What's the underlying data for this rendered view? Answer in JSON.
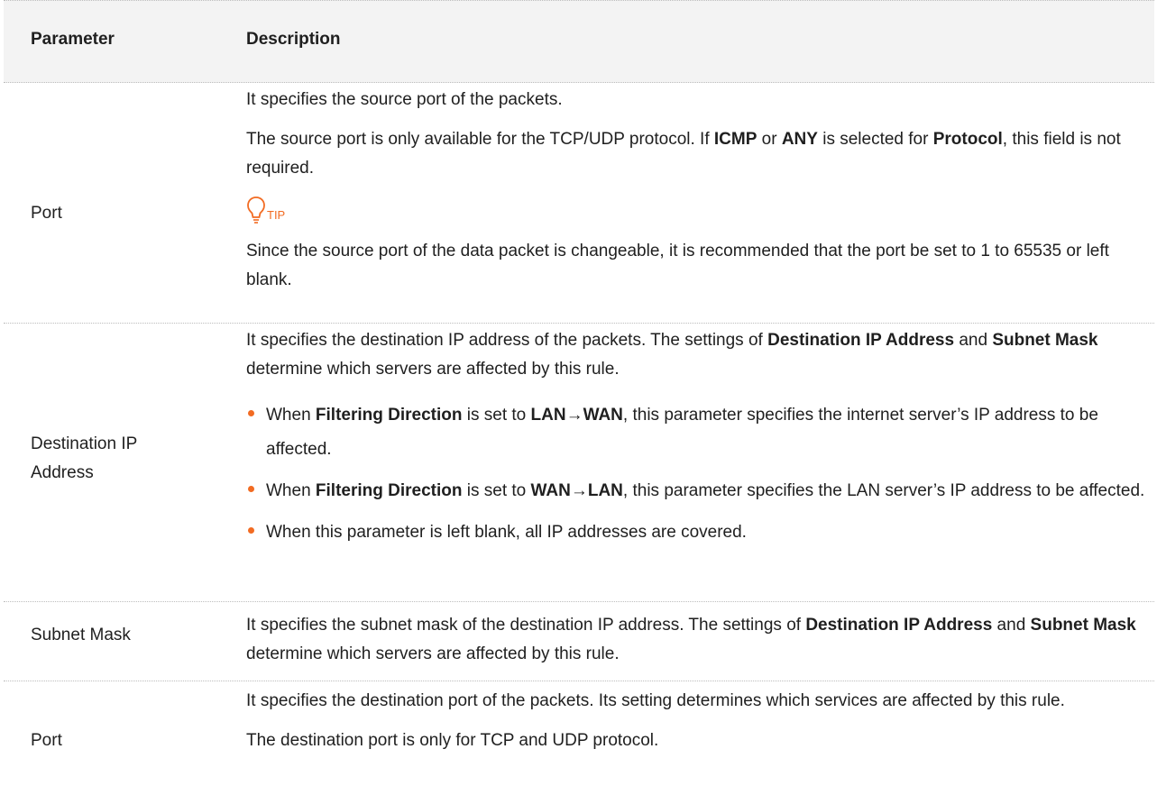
{
  "header": {
    "parameter": "Parameter",
    "description": "Description"
  },
  "rows": [
    {
      "parameter": "Port",
      "p1": "It specifies the source port of the packets.",
      "p2_a": "The source port is only available for the TCP/UDP protocol. If ",
      "p2_b": "ICMP",
      "p2_c": " or ",
      "p2_d": "ANY",
      "p2_e": " is selected for ",
      "p2_f": "Protocol",
      "p2_g": ", this field is not required.",
      "tip_label": "TIP",
      "tip_text": "Since the source port of the data packet is changeable, it is recommended that the port be set to 1 to 65535 or left blank."
    },
    {
      "parameter_line1": "Destination IP",
      "parameter_line2": "Address",
      "p1_a": "It specifies the destination IP address of the packets. The settings of ",
      "p1_b": "Destination IP Address",
      "p1_c": " and ",
      "p1_d": "Subnet Mask",
      "p1_e": " determine which servers are affected by this rule.",
      "b1_a": "When ",
      "b1_b": "Filtering Direction",
      "b1_c": " is set to ",
      "b1_d": "LAN→WAN",
      "b1_e": ", this parameter specifies the internet server’s IP address to be affected.",
      "b2_a": "When ",
      "b2_b": "Filtering Direction",
      "b2_c": " is set to ",
      "b2_d": "WAN→LAN",
      "b2_e": ", this parameter specifies the LAN server’s IP address to be affected.",
      "b3": "When this parameter is left blank, all IP addresses are covered."
    },
    {
      "parameter": "Subnet Mask",
      "p1_a": "It specifies the subnet mask of the destination IP address. The settings of ",
      "p1_b": "Destination IP Address",
      "p1_c": " and ",
      "p1_d": "Subnet Mask",
      "p1_e": " determine which servers are affected by this rule."
    },
    {
      "parameter": "Port",
      "p1": "It specifies the destination port of the packets. Its setting determines which services are affected by this rule.",
      "p2": "The destination port is only for TCP and UDP protocol."
    }
  ],
  "colors": {
    "accent": "#f26b22",
    "header_bg": "#f3f3f3"
  }
}
